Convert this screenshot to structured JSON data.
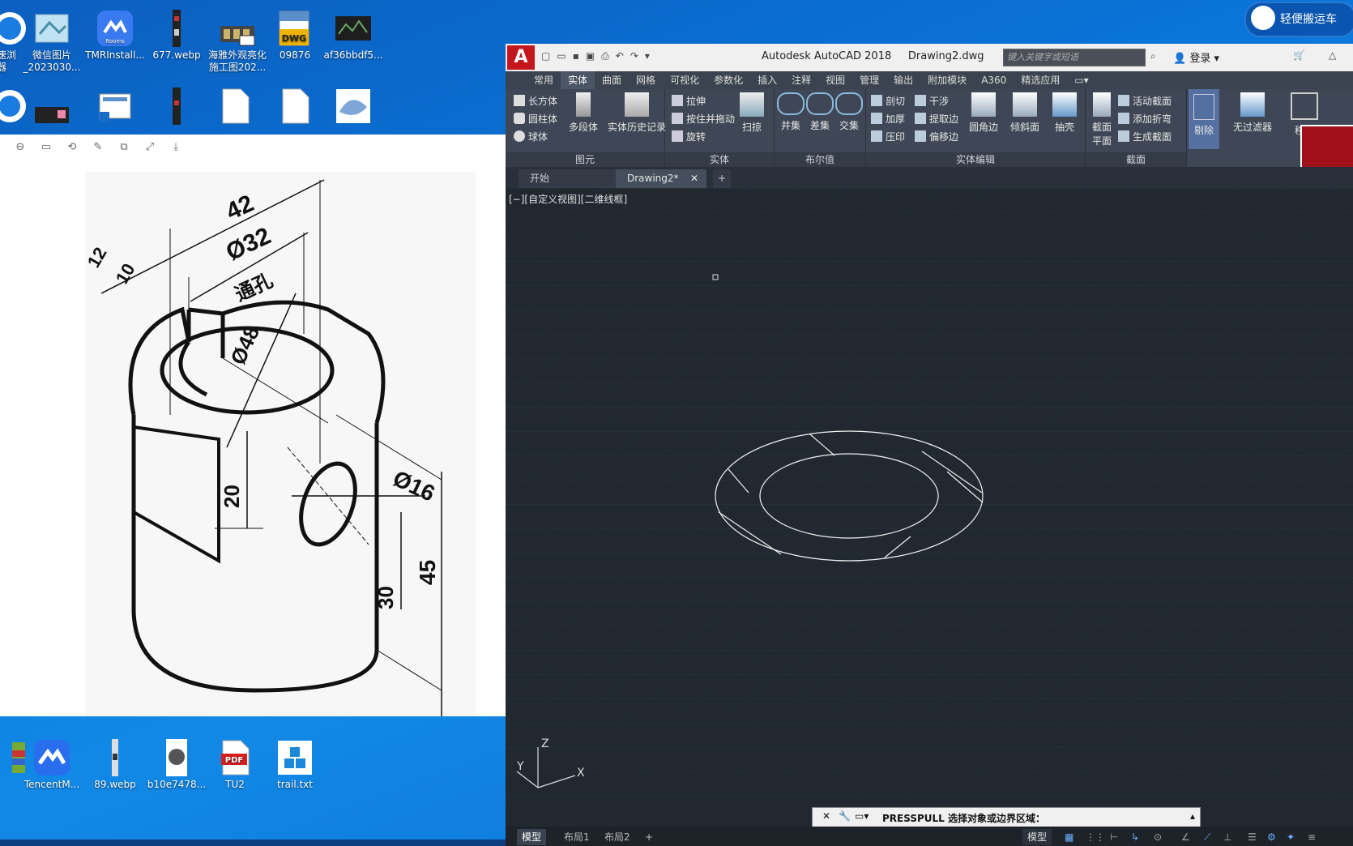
{
  "desktop": {
    "icons_top": [
      {
        "label": "速浏",
        "label2": "器"
      },
      {
        "label": "微信图片",
        "label2": "_2023030..."
      },
      {
        "label": "TMRInstall...",
        "label2": ""
      },
      {
        "label": "677.webp",
        "label2": ""
      },
      {
        "label": "海雅外观亮化",
        "label2": "施工图202..."
      },
      {
        "label": "09876",
        "label2": ""
      },
      {
        "label": "af36bbdf5...",
        "label2": ""
      }
    ],
    "icons_bottom": [
      {
        "label": "TencentM..."
      },
      {
        "label": "89.webp"
      },
      {
        "label": "b10e7478..."
      },
      {
        "label": "TU2"
      },
      {
        "label": "trail.txt"
      }
    ],
    "rooms_badge": "Rooms",
    "dwg_badge": "DWG",
    "pdf_badge": "PDF",
    "qingbian": "轻便搬运车"
  },
  "viewer": {
    "drawing_labels": {
      "dim42": "42",
      "dim32": "Ø32",
      "through": "通孔",
      "dim12": "12",
      "dim10": "10",
      "dim48": "Ø48",
      "dim20": "20",
      "dim16": "Ø16",
      "dim30": "30",
      "dim45": "45"
    }
  },
  "acad": {
    "title": "Autodesk AutoCAD 2018",
    "filename": "Drawing2.dwg",
    "search_placeholder": "键入关键字或短语",
    "login": "登录",
    "tabs": [
      "常用",
      "实体",
      "曲面",
      "网格",
      "可视化",
      "参数化",
      "插入",
      "注释",
      "视图",
      "管理",
      "输出",
      "附加模块",
      "A360",
      "精选应用"
    ],
    "active_tab": "实体",
    "panels": {
      "primitive": {
        "title": "图元",
        "items": [
          "长方体",
          "圆柱体",
          "球体"
        ],
        "big1": "多段体",
        "big2": "实体历史记录"
      },
      "solid": {
        "title": "实体",
        "items": [
          "拉伸",
          "按住并拖动",
          "旋转"
        ],
        "big1": "扫掠"
      },
      "boolean": {
        "title": "布尔值",
        "items": [
          "并集",
          "差集",
          "交集"
        ]
      },
      "edit": {
        "title": "实体编辑",
        "items": [
          "剖切",
          "加厚",
          "压印",
          "干涉",
          "提取边",
          "偏移边"
        ],
        "big1": "圆角边",
        "big2": "倾斜面",
        "big3": "抽壳"
      },
      "section": {
        "title": "截面",
        "big1": "截面",
        "big1b": "平面",
        "items": [
          "活动截面",
          "添加折弯",
          "生成截面"
        ]
      },
      "extra": {
        "big1": "剔除",
        "big2": "无过滤器",
        "big3": "移动"
      }
    },
    "doc_tabs": [
      "开始",
      "Drawing2*"
    ],
    "viewport_label": "[−][自定义视图][二维线框]",
    "ucs": {
      "z": "Z",
      "y": "Y",
      "x": "X"
    },
    "command": "PRESSPULL 选择对象或边界区域：",
    "layout_tabs": [
      "模型",
      "布局1",
      "布局2"
    ],
    "status_model": "模型"
  }
}
